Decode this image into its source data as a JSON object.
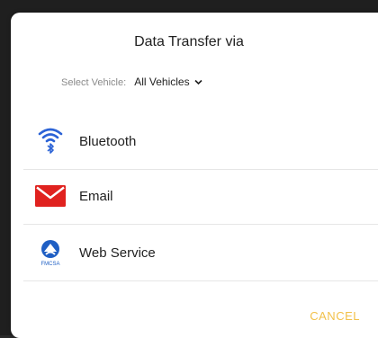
{
  "dialog": {
    "title": "Data Transfer via",
    "select_vehicle_label": "Select Vehicle:",
    "select_vehicle_value": "All Vehicles",
    "options": [
      {
        "label": "Bluetooth",
        "icon": "bluetooth-icon"
      },
      {
        "label": "Email",
        "icon": "email-icon"
      },
      {
        "label": "Web Service",
        "icon": "web-service-icon"
      }
    ],
    "web_service_icon_caption": "FMCSA",
    "cancel_label": "CANCEL"
  },
  "colors": {
    "bluetooth_blue": "#2c63d6",
    "email_red": "#e0221f",
    "web_blue": "#1f5fc4",
    "cancel_yellow": "#f2c14a"
  }
}
